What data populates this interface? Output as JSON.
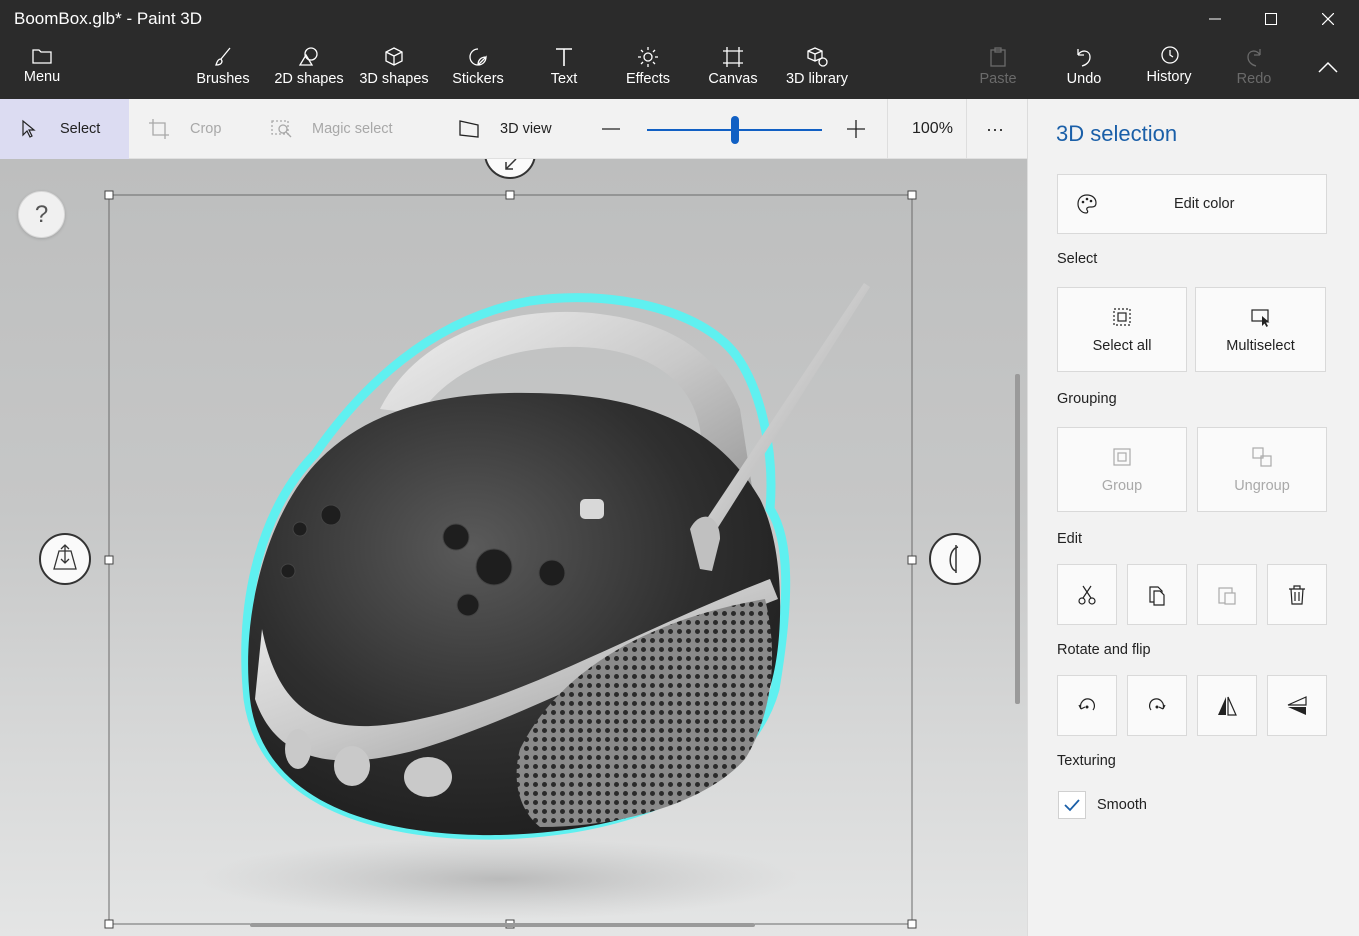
{
  "window": {
    "title": "BoomBox.glb* - Paint 3D"
  },
  "toolbar": {
    "menu": "Menu",
    "brushes": "Brushes",
    "shapes2d": "2D shapes",
    "shapes3d": "3D shapes",
    "stickers": "Stickers",
    "text": "Text",
    "effects": "Effects",
    "canvas": "Canvas",
    "library3d": "3D library",
    "paste": "Paste",
    "undo": "Undo",
    "history": "History",
    "redo": "Redo"
  },
  "subbar": {
    "select": "Select",
    "crop": "Crop",
    "magic_select": "Magic select",
    "view3d": "3D view",
    "zoom": "100%",
    "more": "···"
  },
  "canvas": {
    "help": "?"
  },
  "panel": {
    "title": "3D selection",
    "edit_color": "Edit color",
    "select_heading": "Select",
    "select_all": "Select all",
    "multiselect": "Multiselect",
    "grouping_heading": "Grouping",
    "group": "Group",
    "ungroup": "Ungroup",
    "edit_heading": "Edit",
    "rotate_heading": "Rotate and flip",
    "texturing_heading": "Texturing",
    "smooth": "Smooth"
  },
  "colors": {
    "accent": "#1a5fa8",
    "selection_outline": "#5ff0f0",
    "toolbar_bg": "#2b2b2b"
  }
}
